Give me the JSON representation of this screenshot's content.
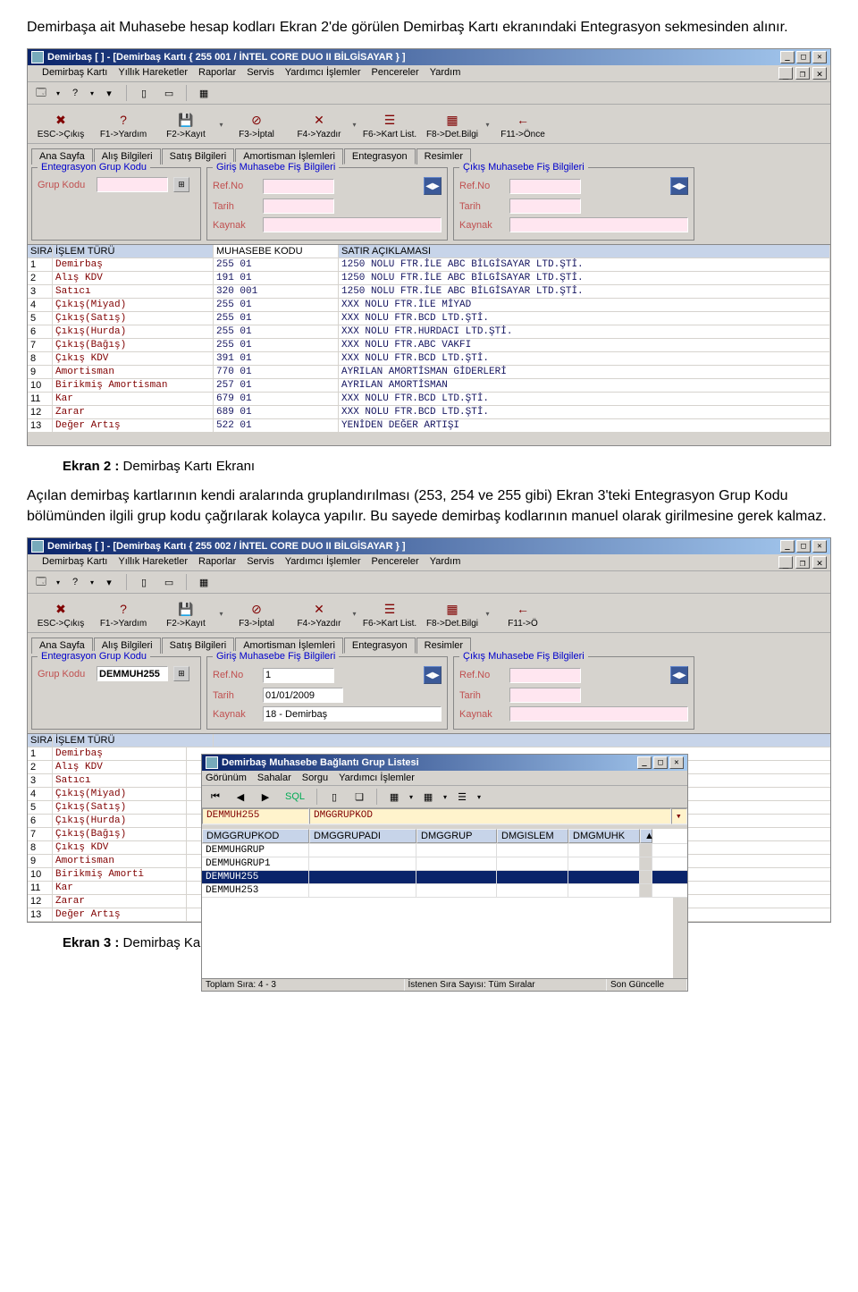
{
  "doc": {
    "para1": "Demirbaşa ait Muhasebe hesap kodları Ekran 2'de görülen Demirbaş Kartı ekranındaki Entegrasyon sekmesinden alınır.",
    "caption1_label": "Ekran 2 :",
    "caption1_text": " Demirbaş Kartı Ekranı",
    "para2": "Açılan demirbaş kartlarının kendi aralarında gruplandırılması (253, 254 ve 255 gibi) Ekran 3'teki Entegrasyon Grup Kodu bölümünden ilgili grup kodu çağrılarak kolayca yapılır. Bu sayede demirbaş kodlarının manuel olarak girilmesine gerek kalmaz.",
    "caption2_label": "Ekran 3 :",
    "caption2_text": " Demirbaş Kartı Entegrasyon Sekmesindeki Entegrasyon Grup Kodlarının Çağrıldığı Ekran"
  },
  "menus": {
    "main": [
      "Demirbaş Kartı",
      "Yıllık Hareketler",
      "Raporlar",
      "Servis",
      "Yardımcı İşlemler",
      "Pencereler",
      "Yardım"
    ],
    "popup": [
      "Görünüm",
      "Sahalar",
      "Sorgu",
      "Yardımcı İşlemler"
    ]
  },
  "funcbar": [
    {
      "icon": "✖",
      "label": "ESC->Çıkış"
    },
    {
      "icon": "?",
      "label": "F1->Yardım"
    },
    {
      "icon": "💾",
      "label": "F2->Kayıt"
    },
    {
      "icon": "⊘",
      "label": "F3->İptal"
    },
    {
      "icon": "✕",
      "label": "F4->Yazdır"
    },
    {
      "icon": "☰",
      "label": "F6->Kart List."
    },
    {
      "icon": "▦",
      "label": "F8->Det.Bilgi"
    }
  ],
  "funcbar_last1": {
    "icon": "←",
    "label": "F11->Önce"
  },
  "funcbar_last2": {
    "icon": "←",
    "label": "F11->Ö"
  },
  "tabs": [
    "Ana Sayfa",
    "Alış Bilgileri",
    "Satış Bilgileri",
    "Amortisman İşlemleri",
    "Entegrasyon",
    "Resimler"
  ],
  "grouplabels": {
    "g1": "Entegrasyon Grup Kodu",
    "g2": "Giriş Muhasebe Fiş Bilgileri",
    "g3": "Çıkış Muhasebe Fiş Bilgileri"
  },
  "fieldlabels": {
    "grup": "Grup Kodu",
    "refno": "Ref.No",
    "tarih": "Tarih",
    "kaynak": "Kaynak"
  },
  "gridhead": {
    "sira": "SIRA N",
    "islem": "İŞLEM TÜRÜ",
    "muh": "MUHASEBE KODU",
    "satir": "SATIR AÇIKLAMASI"
  },
  "window1": {
    "title": "Demirbaş [  ] - [Demirbaş Kartı { 255 001 / İNTEL CORE DUO II BİLGİSAYAR } ]",
    "grup_kodu": "",
    "rows": [
      {
        "n": "1",
        "islem": "Demirbaş",
        "muh": "255 01",
        "satir": "1250 NOLU FTR.İLE ABC BİLGİSAYAR LTD.ŞTİ."
      },
      {
        "n": "2",
        "islem": "Alış KDV",
        "muh": "191 01",
        "satir": "1250 NOLU FTR.İLE ABC BİLGİSAYAR LTD.ŞTİ."
      },
      {
        "n": "3",
        "islem": "Satıcı",
        "muh": "320 001",
        "satir": "1250 NOLU FTR.İLE ABC BİLGİSAYAR LTD.ŞTİ."
      },
      {
        "n": "4",
        "islem": "Çıkış(Miyad)",
        "muh": "255 01",
        "satir": "XXX NOLU FTR.İLE MİYAD"
      },
      {
        "n": "5",
        "islem": "Çıkış(Satış)",
        "muh": "255 01",
        "satir": "XXX NOLU FTR.BCD LTD.ŞTİ."
      },
      {
        "n": "6",
        "islem": "Çıkış(Hurda)",
        "muh": "255 01",
        "satir": "XXX NOLU FTR.HURDACI LTD.ŞTİ."
      },
      {
        "n": "7",
        "islem": "Çıkış(Bağış)",
        "muh": "255 01",
        "satir": "XXX NOLU FTR.ABC VAKFI"
      },
      {
        "n": "8",
        "islem": "Çıkış KDV",
        "muh": "391 01",
        "satir": "XXX NOLU FTR.BCD LTD.ŞTİ."
      },
      {
        "n": "9",
        "islem": "Amortisman",
        "muh": "770 01",
        "satir": "AYRILAN AMORTİSMAN GİDERLERİ"
      },
      {
        "n": "10",
        "islem": "Birikmiş Amortisman",
        "muh": "257 01",
        "satir": "AYRILAN AMORTİSMAN"
      },
      {
        "n": "11",
        "islem": "Kar",
        "muh": "679 01",
        "satir": "XXX NOLU FTR.BCD LTD.ŞTİ."
      },
      {
        "n": "12",
        "islem": "Zarar",
        "muh": "689 01",
        "satir": "XXX NOLU FTR.BCD LTD.ŞTİ."
      },
      {
        "n": "13",
        "islem": "Değer Artış",
        "muh": "522 01",
        "satir": "YENİDEN DEĞER ARTIŞI"
      }
    ]
  },
  "window2": {
    "title": "Demirbaş [  ] - [Demirbaş Kartı { 255 002 / İNTEL CORE DUO II BİLGİSAYAR } ]",
    "grup_kodu": "DEMMUH255",
    "refno": "1",
    "tarih": "01/01/2009",
    "kaynak": "18 - Demirbaş",
    "rows": [
      {
        "n": "1",
        "islem": "Demirbaş"
      },
      {
        "n": "2",
        "islem": "Alış KDV"
      },
      {
        "n": "3",
        "islem": "Satıcı"
      },
      {
        "n": "4",
        "islem": "Çıkış(Miyad)"
      },
      {
        "n": "5",
        "islem": "Çıkış(Satış)"
      },
      {
        "n": "6",
        "islem": "Çıkış(Hurda)"
      },
      {
        "n": "7",
        "islem": "Çıkış(Bağış)"
      },
      {
        "n": "8",
        "islem": "Çıkış KDV"
      },
      {
        "n": "9",
        "islem": "Amortisman"
      },
      {
        "n": "10",
        "islem": "Birikmiş Amorti"
      },
      {
        "n": "11",
        "islem": "Kar"
      },
      {
        "n": "12",
        "islem": "Zarar"
      },
      {
        "n": "13",
        "islem": "Değer Artış"
      }
    ],
    "popup": {
      "title": "Demirbaş Muhasebe Bağlantı Grup Listesi",
      "sql_btn": "SQL",
      "filter1": "DEMMUH255",
      "filter2": "DMGGRUPKOD",
      "cols": [
        "DMGGRUPKOD",
        "DMGGRUPADI",
        "DMGGRUP",
        "DMGISLEM",
        "DMGMUHK"
      ],
      "rows": [
        "DEMMUHGRUP",
        "DEMMUHGRUP1",
        "DEMMUH255",
        "DEMMUH253"
      ],
      "selected_index": 2,
      "status": {
        "left": "Toplam Sıra: 4 - 3",
        "mid": "İstenen Sıra Sayısı: Tüm Sıralar",
        "right": "Son Güncelle"
      }
    }
  }
}
